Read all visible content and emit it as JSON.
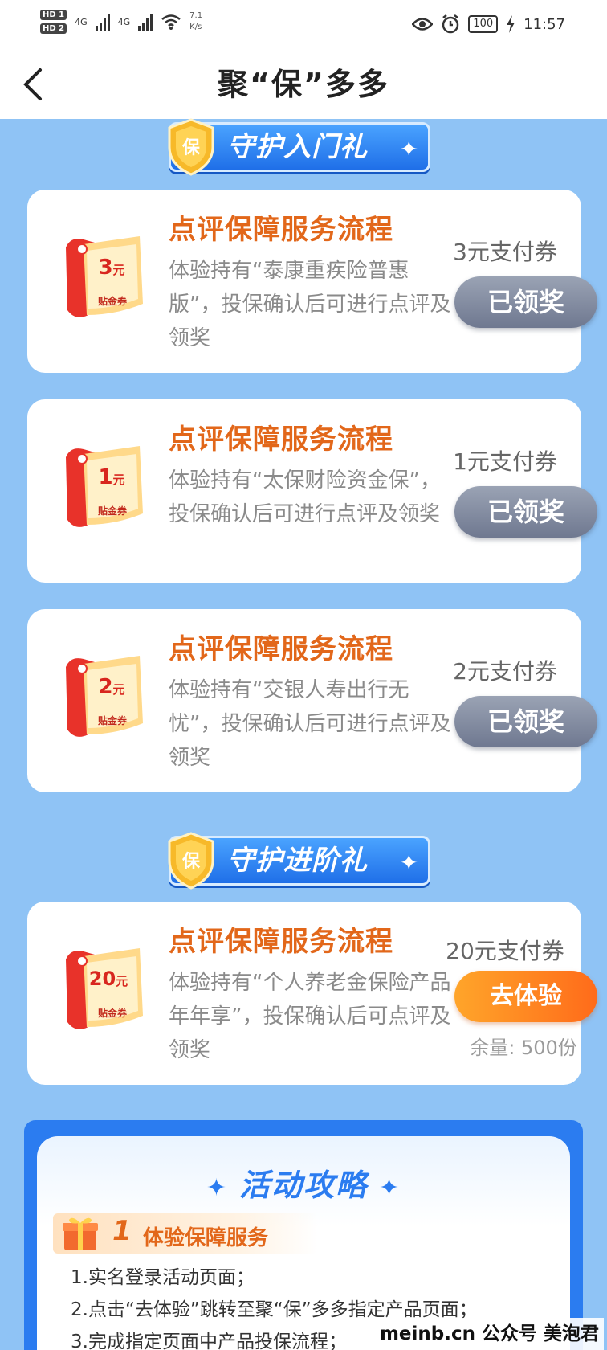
{
  "status_bar": {
    "hd1": "HD 1",
    "hd2": "HD 2",
    "net1": "4G",
    "net2": "4G",
    "speed_value": "7.1",
    "speed_unit": "K/s",
    "battery": "100",
    "time": "11:57"
  },
  "header": {
    "title": "聚“保”多多",
    "back_icon": "chevron-left-icon"
  },
  "sections": [
    {
      "ribbon": "守护入门礼",
      "badge_char": "保"
    },
    {
      "ribbon": "守护进阶礼",
      "badge_char": "保"
    }
  ],
  "cards": [
    {
      "title": "点评保障服务流程",
      "description": "体验持有“泰康重疾险普惠版”，投保确认后可进行点评及领奖",
      "reward": "3元支付券",
      "coupon_amount": "3",
      "coupon_unit": "元",
      "coupon_label": "贴金券",
      "button": "已领奖"
    },
    {
      "title": "点评保障服务流程",
      "description": "体验持有“太保财险资金保”，投保确认后可进行点评及领奖",
      "reward": "1元支付券",
      "coupon_amount": "1",
      "coupon_unit": "元",
      "coupon_label": "贴金券",
      "button": "已领奖"
    },
    {
      "title": "点评保障服务流程",
      "description": "体验持有“交银人寿出行无忧”，投保确认后可进行点评及领奖",
      "reward": "2元支付券",
      "coupon_amount": "2",
      "coupon_unit": "元",
      "coupon_label": "贴金券",
      "button": "已领奖"
    },
    {
      "title": "点评保障服务流程",
      "description": "体验持有“个人养老金保险产品年年享”，投保确认后可点评及领奖",
      "reward": "20元支付券",
      "coupon_amount": "20",
      "coupon_unit": "元",
      "coupon_label": "贴金券",
      "button": "去体验",
      "stock": "余量: 500份"
    }
  ],
  "strategy": {
    "title": "活动攻略",
    "step_number": "1",
    "step_title": "体验保障服务",
    "items": [
      "1.实名登录活动页面；",
      "2.点击“去体验”跳转至聚“保”多多指定产品页面；",
      "3.完成指定页面中产品投保流程；"
    ]
  },
  "watermark": "meinb.cn  公众号 美泡君",
  "colors": {
    "page_bg": "#8fc3f5",
    "title_orange": "#e2671a",
    "claimed_gray": "#7c8599",
    "try_orange": "#ff7a1f",
    "ribbon_blue": "#1f6fe8"
  }
}
